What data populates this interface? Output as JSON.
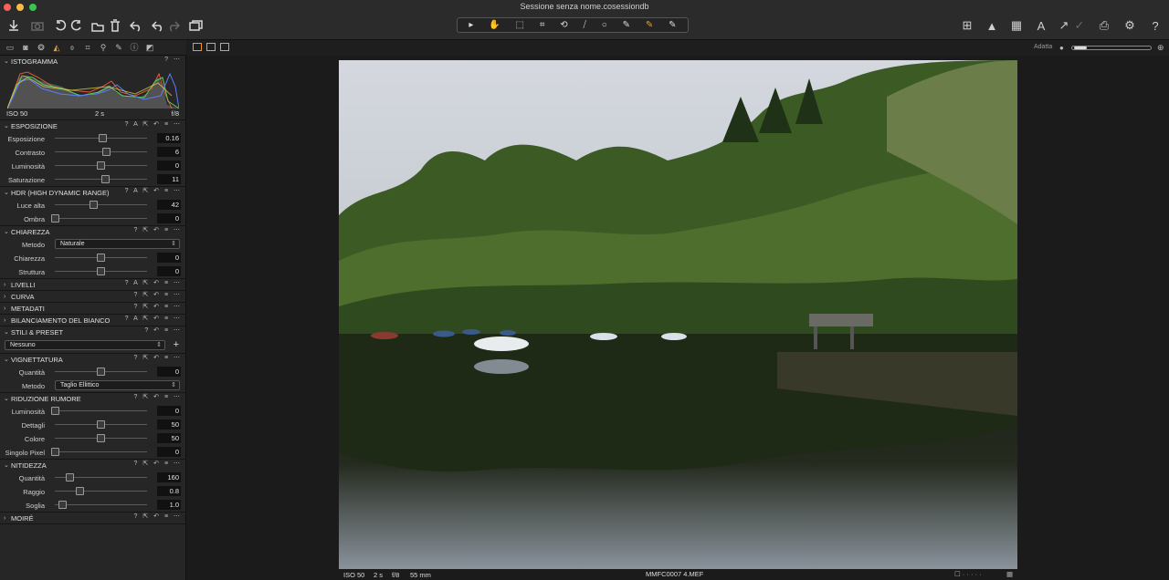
{
  "window": {
    "title": "Sessione senza nome.cosessiondb"
  },
  "colors": {
    "accent": "#f09a2a",
    "close": "#fc605b",
    "minimize": "#fdbc40",
    "zoom": "#34c84a"
  },
  "toolbar_icons": [
    "import-icon",
    "camera-icon",
    "rotate-left-icon",
    "rotate-right-icon",
    "move-icon",
    "trash-icon",
    "undo-icon",
    "redo-icon",
    "stack-icon"
  ],
  "cursor_tools": [
    "▸",
    "✋",
    "⬚",
    "⌗",
    "⟲",
    "⧸",
    "○",
    "✎",
    "✎",
    "✎"
  ],
  "right_icons": [
    "grid-icon",
    "warning-icon",
    "focus-icon",
    "text-icon",
    "cursor-icon",
    "print-icon",
    "gear-icon",
    "help-icon"
  ],
  "right_labels": {
    "grid": "⊞",
    "warning": "▲",
    "focus": "▦",
    "text": "A",
    "cursor": "↗",
    "eyedrop": "✓",
    "print": "⎙",
    "gear": "⚙",
    "help": "?"
  },
  "viewer": {
    "fit_label": "Adatta"
  },
  "histogram": {
    "title": "ISTOGRAMMA",
    "iso": "ISO 50",
    "shutter": "2 s",
    "aperture": "f/8"
  },
  "exposure": {
    "title": "ESPOSIZIONE",
    "rows": [
      {
        "label": "Esposizione",
        "value": "0.16",
        "pos": 0.52
      },
      {
        "label": "Contrasto",
        "value": "6",
        "pos": 0.56
      },
      {
        "label": "Luminosità",
        "value": "0",
        "pos": 0.5
      },
      {
        "label": "Saturazione",
        "value": "11",
        "pos": 0.55
      }
    ]
  },
  "hdr": {
    "title": "HDR (HIGH DYNAMIC RANGE)",
    "rows": [
      {
        "label": "Luce alta",
        "value": "42",
        "pos": 0.42
      },
      {
        "label": "Ombra",
        "value": "0",
        "pos": 0.0
      }
    ]
  },
  "clarity": {
    "title": "CHIAREZZA",
    "method_label": "Metodo",
    "method_value": "Naturale",
    "rows": [
      {
        "label": "Chiarezza",
        "value": "0",
        "pos": 0.5
      },
      {
        "label": "Struttura",
        "value": "0",
        "pos": 0.5
      }
    ]
  },
  "collapsed": [
    {
      "title": "LIVELLI"
    },
    {
      "title": "CURVA"
    },
    {
      "title": "METADATI"
    },
    {
      "title": "BILANCIAMENTO DEL BIANCO"
    }
  ],
  "styles": {
    "title": "STILI & PRESET",
    "value": "Nessuno"
  },
  "vignetting": {
    "title": "VIGNETTATURA",
    "rows": [
      {
        "label": "Quantità",
        "value": "0",
        "pos": 0.5
      }
    ],
    "method_label": "Metodo",
    "method_value": "Taglio Ellittico"
  },
  "noise": {
    "title": "RIDUZIONE RUMORE",
    "rows": [
      {
        "label": "Luminosità",
        "value": "0",
        "pos": 0.0
      },
      {
        "label": "Dettagli",
        "value": "50",
        "pos": 0.5
      },
      {
        "label": "Colore",
        "value": "50",
        "pos": 0.5
      },
      {
        "label": "Singolo Pixel",
        "value": "0",
        "pos": 0.0
      }
    ]
  },
  "sharpening": {
    "title": "NITIDEZZA",
    "rows": [
      {
        "label": "Quantità",
        "value": "160",
        "pos": 0.16
      },
      {
        "label": "Raggio",
        "value": "0.8",
        "pos": 0.27
      },
      {
        "label": "Soglia",
        "value": "1.0",
        "pos": 0.08
      }
    ]
  },
  "moire": {
    "title": "MOIRÉ"
  },
  "status": {
    "iso": "ISO 50",
    "shutter": "2 s",
    "aperture": "f/8",
    "focal": "55 mm",
    "filename": "MMFC0007 4.MEF"
  }
}
